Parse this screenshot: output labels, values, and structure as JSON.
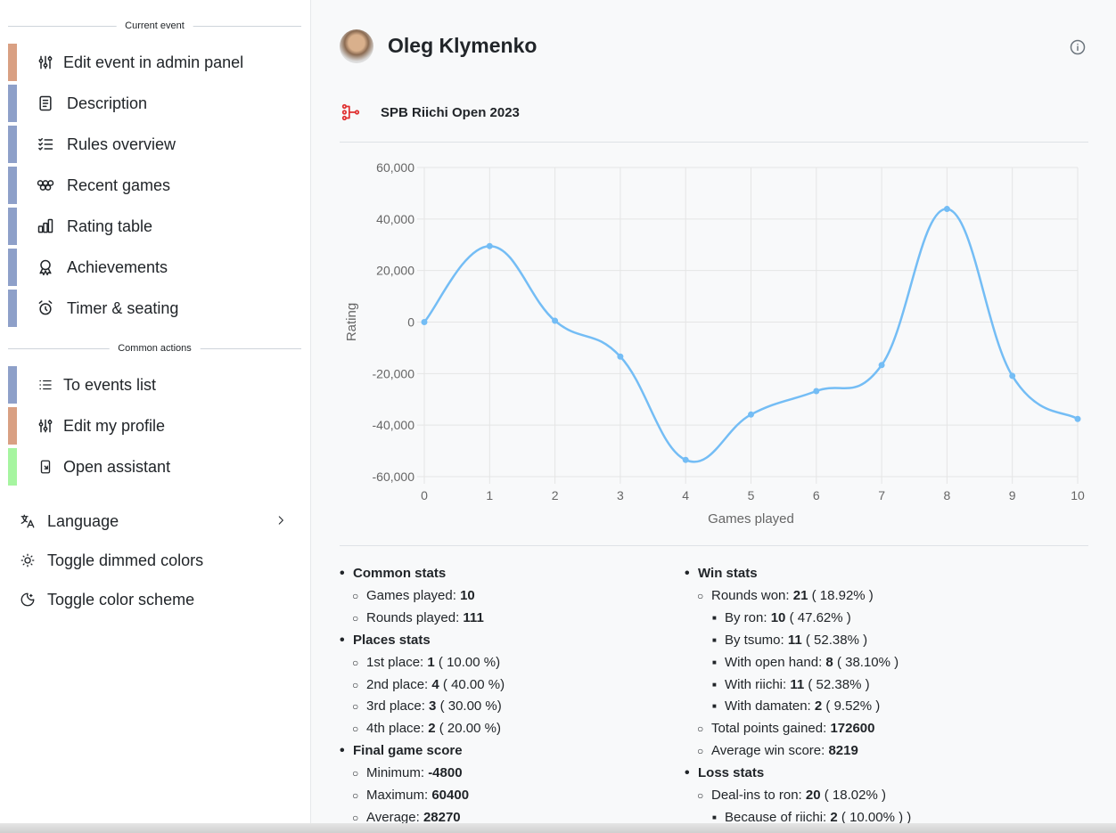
{
  "sidebar": {
    "current_event_label": "Current event",
    "common_actions_label": "Common actions",
    "event_items": [
      {
        "label": "Edit event in admin panel",
        "icon": "adjustments-icon",
        "color": "#d9a083"
      },
      {
        "label": "Description",
        "icon": "document-icon",
        "color": "#8ea0c9"
      },
      {
        "label": "Rules overview",
        "icon": "checklist-icon",
        "color": "#8ea0c9"
      },
      {
        "label": "Recent games",
        "icon": "rings-icon",
        "color": "#8ea0c9"
      },
      {
        "label": "Rating table",
        "icon": "chart-bars-icon",
        "color": "#8ea0c9"
      },
      {
        "label": "Achievements",
        "icon": "award-icon",
        "color": "#8ea0c9"
      },
      {
        "label": "Timer & seating",
        "icon": "alarm-icon",
        "color": "#8ea0c9"
      }
    ],
    "common_items": [
      {
        "label": "To events list",
        "icon": "list-icon",
        "color": "#8ea0c9"
      },
      {
        "label": "Edit my profile",
        "icon": "adjustments-icon",
        "color": "#d9a083"
      },
      {
        "label": "Open assistant",
        "icon": "device-mobile-icon",
        "color": "#a6f5a0"
      }
    ],
    "settings": [
      {
        "label": "Language",
        "icon": "language-icon"
      },
      {
        "label": "Toggle dimmed colors",
        "icon": "sun-icon"
      },
      {
        "label": "Toggle color scheme",
        "icon": "moon-icon"
      }
    ]
  },
  "player": {
    "name": "Oleg Klymenko"
  },
  "event": {
    "title": "SPB Riichi Open 2023"
  },
  "chart_data": {
    "type": "line",
    "xlabel": "Games played",
    "ylabel": "Rating",
    "x": [
      0,
      1,
      2,
      3,
      4,
      5,
      6,
      7,
      8,
      9,
      10
    ],
    "values": [
      0,
      29500,
      500,
      -13400,
      -53500,
      -35900,
      -26800,
      -16700,
      43900,
      -20900,
      -37600
    ],
    "xlim": [
      0,
      10
    ],
    "ylim": [
      -60000,
      60000
    ],
    "y_ticks": [
      "60,000",
      "40,000",
      "20,000",
      "0",
      "-20,000",
      "-40,000",
      "-60,000"
    ],
    "x_ticks": [
      "0",
      "1",
      "2",
      "3",
      "4",
      "5",
      "6",
      "7",
      "8",
      "9",
      "10"
    ],
    "grid": true,
    "line_color": "#74bdf5"
  },
  "stats": {
    "common": {
      "title": "Common stats",
      "games_played_label": "Games played:",
      "games_played": "10",
      "rounds_played_label": "Rounds played:",
      "rounds_played": "111"
    },
    "places": {
      "title": "Places stats",
      "items": [
        {
          "label": "1st place:",
          "value": "1",
          "pct": "( 10.00 %)"
        },
        {
          "label": "2nd place:",
          "value": "4",
          "pct": "( 40.00 %)"
        },
        {
          "label": "3rd place:",
          "value": "3",
          "pct": "( 30.00 %)"
        },
        {
          "label": "4th place:",
          "value": "2",
          "pct": "( 20.00 %)"
        }
      ]
    },
    "final_score": {
      "title": "Final game score",
      "items": [
        {
          "label": "Minimum:",
          "value": "-4800"
        },
        {
          "label": "Maximum:",
          "value": "60400"
        },
        {
          "label": "Average:",
          "value": "28270"
        }
      ]
    },
    "win": {
      "title": "Win stats",
      "rounds_won_label": "Rounds won:",
      "rounds_won": "21",
      "rounds_won_pct": "( 18.92% )",
      "sub": [
        {
          "label": "By ron:",
          "value": "10",
          "pct": "( 47.62% )"
        },
        {
          "label": "By tsumo:",
          "value": "11",
          "pct": "( 52.38% )"
        },
        {
          "label": "With open hand:",
          "value": "8",
          "pct": "( 38.10% )"
        },
        {
          "label": "With riichi:",
          "value": "11",
          "pct": "( 52.38% )"
        },
        {
          "label": "With damaten:",
          "value": "2",
          "pct": "( 9.52% )"
        }
      ],
      "total_points_label": "Total points gained:",
      "total_points": "172600",
      "avg_win_label": "Average win score:",
      "avg_win": "8219"
    },
    "loss": {
      "title": "Loss stats",
      "dealins_label": "Deal-ins to ron:",
      "dealins": "20",
      "dealins_pct": "( 18.02% )",
      "riichi_label": "Because of riichi:",
      "riichi": "2",
      "riichi_pct": "( 10.00% ) )"
    }
  }
}
